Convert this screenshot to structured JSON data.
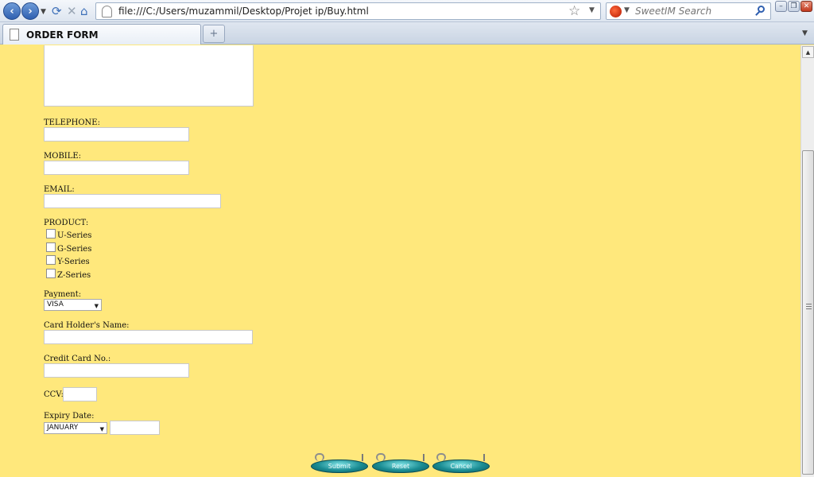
{
  "browser": {
    "url": "file:///C:/Users/muzammil/Desktop/Projet ip/Buy.html",
    "search_placeholder": "SweetIM Search",
    "tab_title": "ORDER FORM",
    "icons": {
      "back": "back-arrow-icon",
      "forward": "forward-arrow-icon",
      "reload": "reload-icon",
      "stop": "stop-icon",
      "home": "home-icon",
      "bookmark": "star-icon",
      "search_engine": "sweetim-logo-icon",
      "search_go": "magnifier-icon"
    }
  },
  "form": {
    "telephone_label": "TELEPHONE:",
    "mobile_label": "MOBILE:",
    "email_label": "EMAIL:",
    "product_label": "PRODUCT:",
    "products": [
      "U-Series",
      "G-Series",
      "Y-Series",
      "Z-Series"
    ],
    "payment_label": "Payment:",
    "payment_value": "VISA",
    "card_holder_label": "Card Holder's Name:",
    "card_number_label": "Credit Card No.:",
    "ccv_label": "CCV:",
    "expiry_label": "Expiry Date:",
    "expiry_month": "JANUARY",
    "buttons": {
      "submit": "Submit",
      "reset": "Reset",
      "cancel": "Cancel"
    }
  },
  "colors": {
    "page_background": "#ffe87c",
    "button_teal": "#1a8c93"
  }
}
